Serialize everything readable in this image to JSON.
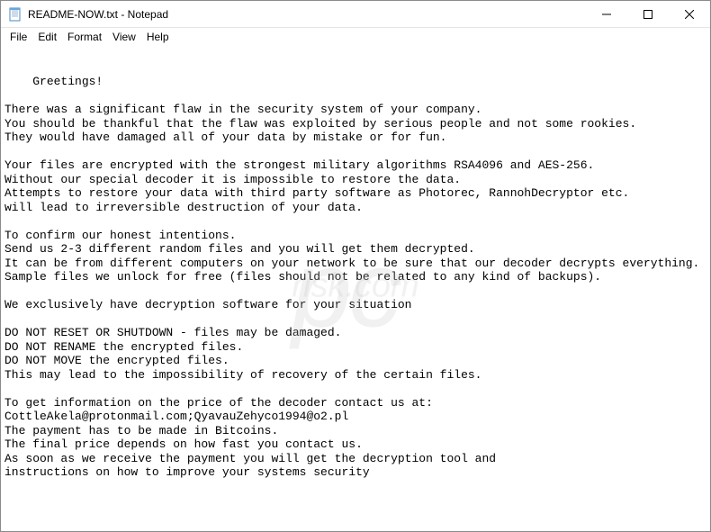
{
  "window": {
    "title": "README-NOW.txt - Notepad"
  },
  "menubar": {
    "items": [
      "File",
      "Edit",
      "Format",
      "View",
      "Help"
    ]
  },
  "content": {
    "text": "Greetings!\n\nThere was a significant flaw in the security system of your company.\nYou should be thankful that the flaw was exploited by serious people and not some rookies.\nThey would have damaged all of your data by mistake or for fun.\n\nYour files are encrypted with the strongest military algorithms RSA4096 and AES-256.\nWithout our special decoder it is impossible to restore the data.\nAttempts to restore your data with third party software as Photorec, RannohDecryptor etc.\nwill lead to irreversible destruction of your data.\n\nTo confirm our honest intentions.\nSend us 2-3 different random files and you will get them decrypted.\nIt can be from different computers on your network to be sure that our decoder decrypts everything.\nSample files we unlock for free (files should not be related to any kind of backups).\n\nWe exclusively have decryption software for your situation\n\nDO NOT RESET OR SHUTDOWN - files may be damaged.\nDO NOT RENAME the encrypted files.\nDO NOT MOVE the encrypted files.\nThis may lead to the impossibility of recovery of the certain files.\n\nTo get information on the price of the decoder contact us at:\nCottleAkela@protonmail.com;QyavauZehyco1994@o2.pl\nThe payment has to be made in Bitcoins.\nThe final price depends on how fast you contact us.\nAs soon as we receive the payment you will get the decryption tool and\ninstructions on how to improve your systems security"
  },
  "watermark": {
    "main": "pc",
    "sub": "risk.com"
  }
}
